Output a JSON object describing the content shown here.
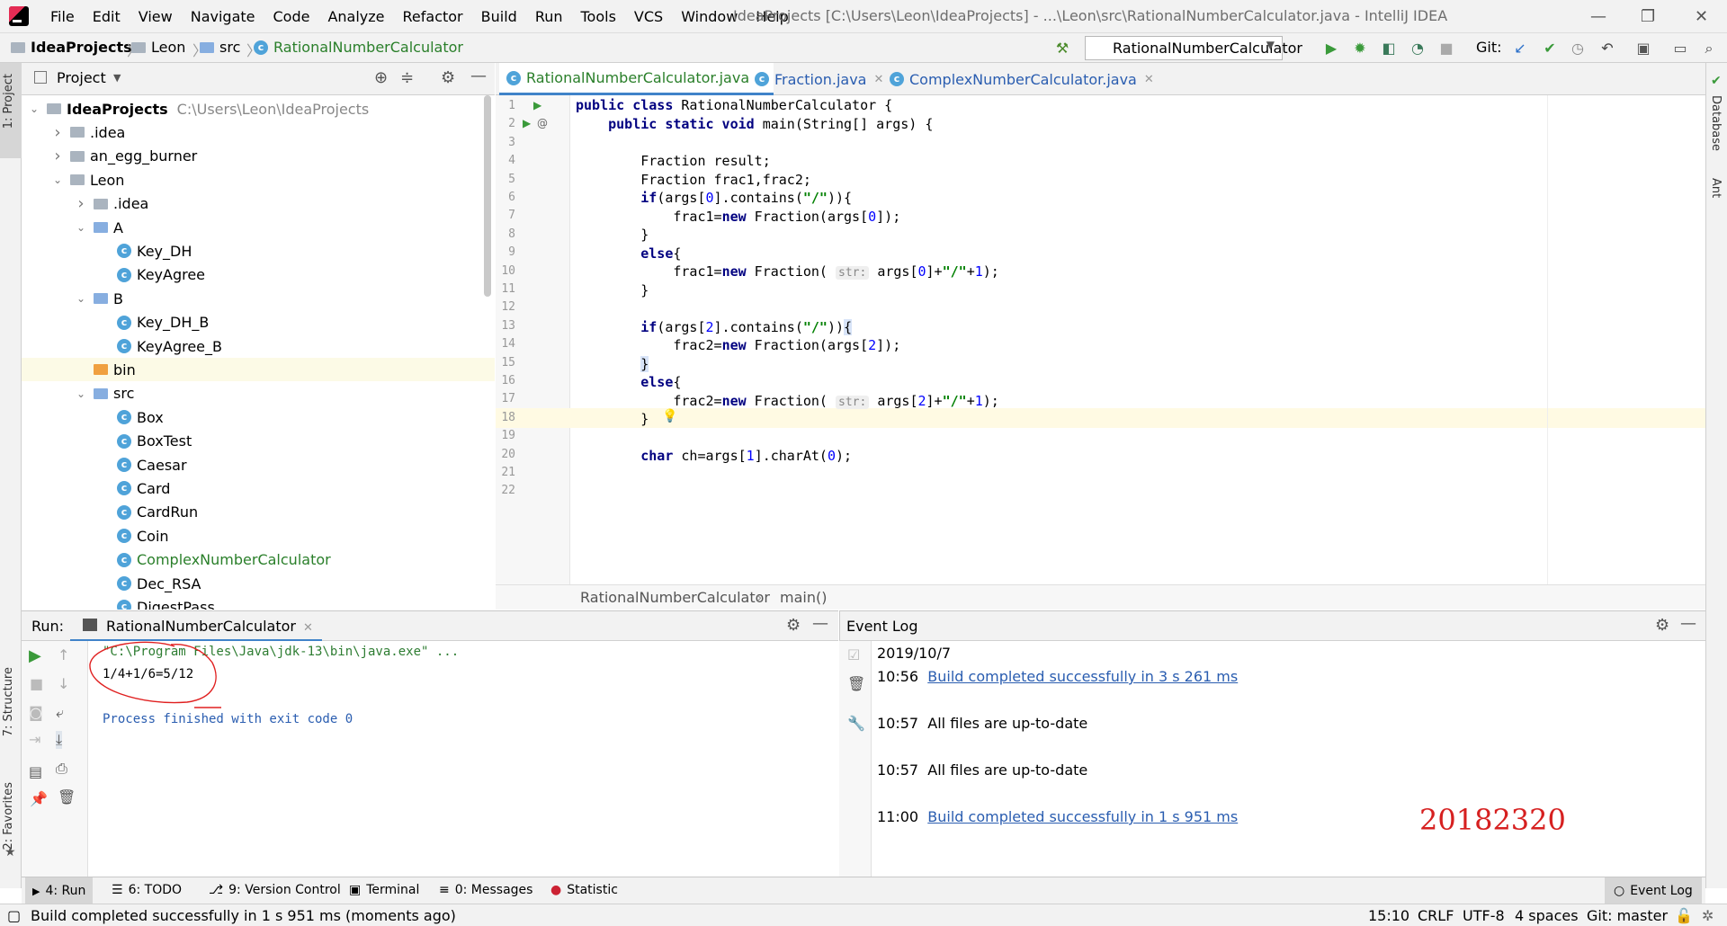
{
  "menubar": {
    "items": [
      "File",
      "Edit",
      "View",
      "Navigate",
      "Code",
      "Analyze",
      "Refactor",
      "Build",
      "Run",
      "Tools",
      "VCS",
      "Window",
      "Help"
    ],
    "window_title": "IdeaProjects [C:\\Users\\Leon\\IdeaProjects] - ...\\Leon\\src\\RationalNumberCalculator.java - IntelliJ IDEA"
  },
  "navbar": {
    "crumbs": [
      "IdeaProjects",
      "Leon",
      "src",
      "RationalNumberCalculator"
    ],
    "run_config": "RationalNumberCalculator",
    "git_label": "Git:"
  },
  "project_panel": {
    "title": "Project",
    "tree": [
      {
        "label": "IdeaProjects",
        "hint": "C:\\Users\\Leon\\IdeaProjects",
        "depth": 0,
        "type": "module",
        "expanded": true
      },
      {
        "label": ".idea",
        "depth": 1,
        "type": "folder",
        "expanded": false
      },
      {
        "label": "an_egg_burner",
        "depth": 1,
        "type": "folder",
        "expanded": false
      },
      {
        "label": "Leon",
        "depth": 1,
        "type": "folder",
        "expanded": true
      },
      {
        "label": ".idea",
        "depth": 2,
        "type": "folder",
        "expanded": false
      },
      {
        "label": "A",
        "depth": 2,
        "type": "src-folder",
        "expanded": true
      },
      {
        "label": "Key_DH",
        "depth": 3,
        "type": "class"
      },
      {
        "label": "KeyAgree",
        "depth": 3,
        "type": "class"
      },
      {
        "label": "B",
        "depth": 2,
        "type": "src-folder",
        "expanded": true
      },
      {
        "label": "Key_DH_B",
        "depth": 3,
        "type": "class"
      },
      {
        "label": "KeyAgree_B",
        "depth": 3,
        "type": "class"
      },
      {
        "label": "bin",
        "depth": 2,
        "type": "excluded-folder"
      },
      {
        "label": "src",
        "depth": 2,
        "type": "src-folder",
        "expanded": true
      },
      {
        "label": "Box",
        "depth": 3,
        "type": "class"
      },
      {
        "label": "BoxTest",
        "depth": 3,
        "type": "class"
      },
      {
        "label": "Caesar",
        "depth": 3,
        "type": "class"
      },
      {
        "label": "Card",
        "depth": 3,
        "type": "class"
      },
      {
        "label": "CardRun",
        "depth": 3,
        "type": "class"
      },
      {
        "label": "Coin",
        "depth": 3,
        "type": "class"
      },
      {
        "label": "ComplexNumberCalculator",
        "depth": 3,
        "type": "class",
        "modified": true
      },
      {
        "label": "Dec_RSA",
        "depth": 3,
        "type": "class"
      },
      {
        "label": "DigestPass",
        "depth": 3,
        "type": "class"
      }
    ]
  },
  "editor": {
    "tabs": [
      {
        "label": "RationalNumberCalculator.java",
        "active": true
      },
      {
        "label": "Fraction.java",
        "active": false
      },
      {
        "label": "ComplexNumberCalculator.java",
        "active": false
      }
    ],
    "line_numbers": [
      "1",
      "2",
      "3",
      "4",
      "5",
      "6",
      "7",
      "8",
      "9",
      "10",
      "11",
      "12",
      "13",
      "14",
      "15",
      "16",
      "17",
      "18",
      "19",
      "20",
      "21",
      "22"
    ],
    "breadcrumb": [
      "RationalNumberCalculator",
      "main()"
    ]
  },
  "run_panel": {
    "label": "Run:",
    "tab": "RationalNumberCalculator",
    "console": [
      "\"C:\\Program Files\\Java\\jdk-13\\bin\\java.exe\" ...",
      "1/4+1/6=5/12",
      "Process finished with exit code 0"
    ]
  },
  "event_log": {
    "title": "Event Log",
    "date": "2019/10/7",
    "entries": [
      {
        "time": "10:56",
        "text": "Build completed successfully in 3 s 261 ms",
        "link": true
      },
      {
        "time": "10:57",
        "text": "All files are up-to-date",
        "link": false
      },
      {
        "time": "10:57",
        "text": "All files are up-to-date",
        "link": false
      },
      {
        "time": "11:00",
        "text": "Build completed successfully in 1 s 951 ms",
        "link": true
      }
    ],
    "watermark": "20182320"
  },
  "bottom_tools": [
    {
      "label": "4: Run",
      "icon": "play-icon"
    },
    {
      "label": "6: TODO",
      "icon": "list-icon"
    },
    {
      "label": "9: Version Control",
      "icon": "vcs-icon"
    },
    {
      "label": "Terminal",
      "icon": "terminal-icon"
    },
    {
      "label": "0: Messages",
      "icon": "messages-icon"
    },
    {
      "label": "Statistic",
      "icon": "statistic-icon"
    }
  ],
  "event_log_button": "Event Log",
  "status_bar": {
    "message": "Build completed successfully in 1 s 951 ms (moments ago)",
    "position": "15:10",
    "line_sep": "CRLF",
    "encoding": "UTF-8",
    "indent": "4 spaces",
    "git_branch": "Git: master"
  },
  "side_tabs": {
    "left_top": "1: Project",
    "left_structure": "7: Structure",
    "left_favorites": "2: Favorites",
    "right_database": "Database",
    "right_ant": "Ant"
  },
  "colors": {
    "accent": "#4083c9",
    "link": "#2a5db0",
    "console_path": "#2e7d32",
    "watermark": "#d62020"
  }
}
